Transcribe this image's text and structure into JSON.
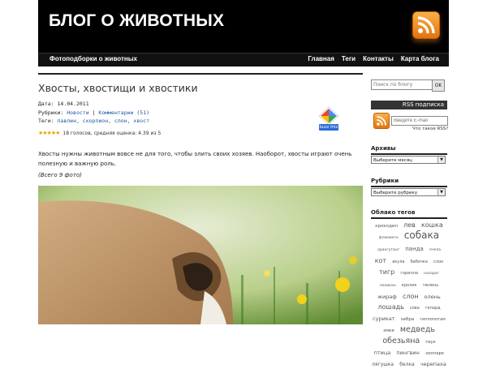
{
  "header": {
    "site_title": "БЛОГ О ЖИВОТНЫХ"
  },
  "navbar": {
    "left": "Фотоподборки о животных",
    "items": [
      "Главная",
      "Теги",
      "Контакты",
      "Карта блога"
    ]
  },
  "post": {
    "title": "Хвосты, хвостищи и хвостики",
    "date_label": "Дата:",
    "date": "14.04.2011",
    "rubrics_label": "Рубрики:",
    "rubric_news": "Новости",
    "separator": "|",
    "comments": "Комментарии (51)",
    "tags_label": "Теги:",
    "tags": "павлин, скорпион, слон, хвост",
    "rating_text": "18 голосов, средняя оценка: 4.39 из 5",
    "buzz": "buzz this",
    "body": "Хвосты нужны животным вовсе не для того, чтобы злить своих хозяев. Наоборот, хвосты играют очень полезную и важную роль.",
    "photo_count": "(Всего 9 фото)"
  },
  "sidebar": {
    "search_placeholder": "Поиск по блогу",
    "search_button": "OK",
    "rss_title": "RSS подписка",
    "email_placeholder": "Введите E-mail",
    "what_rss": "Что такое RSS?",
    "archives_title": "Архивы",
    "archives_select": "Выберите месяц",
    "rubrics_title": "Рубрики",
    "rubrics_select": "Выберите рубрику",
    "tagcloud_title": "Облако тегов",
    "tags": [
      {
        "t": "крокодил",
        "s": 5.5
      },
      {
        "t": "лев",
        "s": 8
      },
      {
        "t": "кошка",
        "s": 8
      },
      {
        "t": "фламинго",
        "s": 4.5
      },
      {
        "t": "собака",
        "s": 12
      },
      {
        "t": "орангутанг",
        "s": 4.5
      },
      {
        "t": "панда",
        "s": 7
      },
      {
        "t": "пчела",
        "s": 4.5
      },
      {
        "t": "кот",
        "s": 8
      },
      {
        "t": "акула",
        "s": 5
      },
      {
        "t": "бабочка",
        "s": 5
      },
      {
        "t": "слон",
        "s": 5
      },
      {
        "t": "тигр",
        "s": 8
      },
      {
        "t": "горилла",
        "s": 5
      },
      {
        "t": "носорог",
        "s": 4.5
      },
      {
        "t": "пеликан",
        "s": 4.5
      },
      {
        "t": "кролик",
        "s": 5
      },
      {
        "t": "тюлень",
        "s": 5
      },
      {
        "t": "жираф",
        "s": 6.5
      },
      {
        "t": "слон",
        "s": 8
      },
      {
        "t": "олень",
        "s": 6.5
      },
      {
        "t": "лошадь",
        "s": 8
      },
      {
        "t": "сова",
        "s": 5
      },
      {
        "t": "гепард",
        "s": 5
      },
      {
        "t": "сурикат",
        "s": 6.5
      },
      {
        "t": "зебра",
        "s": 5.5
      },
      {
        "t": "гиппопотам",
        "s": 5
      },
      {
        "t": "змея",
        "s": 5.5
      },
      {
        "t": "медведь",
        "s": 9.5
      },
      {
        "t": "обезьяна",
        "s": 9.5
      },
      {
        "t": "паук",
        "s": 5
      },
      {
        "t": "птица",
        "s": 6.5
      },
      {
        "t": "пингвин",
        "s": 6.5
      },
      {
        "t": "зоопарк",
        "s": 5.5
      },
      {
        "t": "лягушка",
        "s": 6
      },
      {
        "t": "белка",
        "s": 6
      },
      {
        "t": "черепаха",
        "s": 6.5
      }
    ]
  },
  "colors": {
    "header_bg": "#000000",
    "link": "#1a57a6",
    "rss_orange": "#f28a1c"
  }
}
